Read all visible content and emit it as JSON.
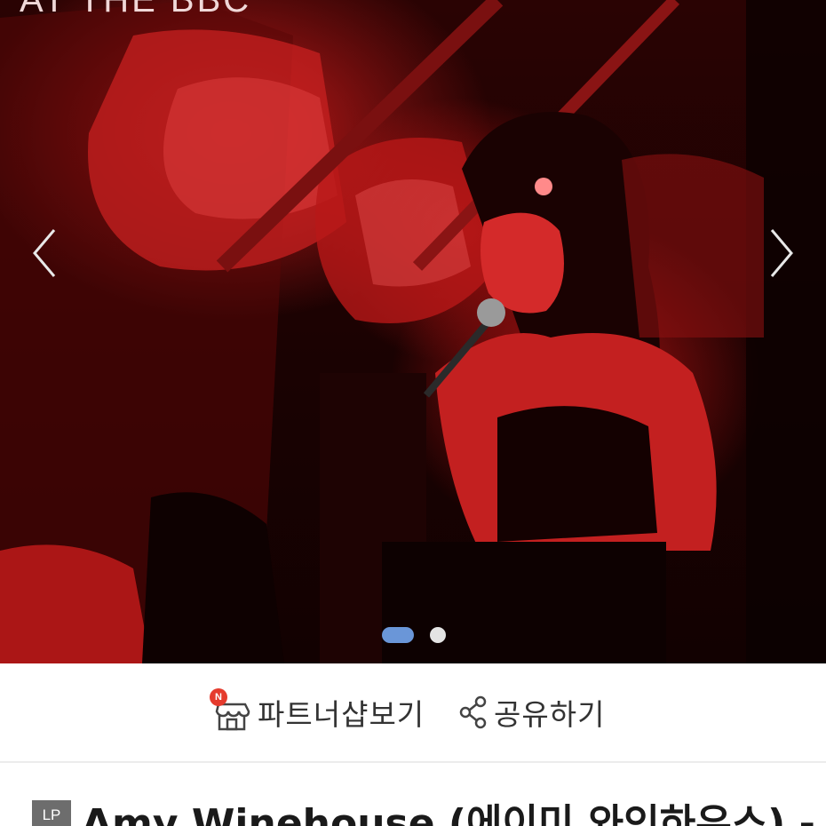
{
  "carousel": {
    "image_text": "AT THE BBC",
    "prev_icon": "chevron-left-icon",
    "next_icon": "chevron-right-icon",
    "slide_count": 2,
    "active_slide": 1,
    "colors": {
      "active_dot": "#6a96d8",
      "inactive_dot": "#e4e4e4",
      "tint": "#c81a1a"
    }
  },
  "actions": {
    "partner_shop": {
      "label": "파트너샵보기",
      "icon": "store-icon",
      "badge": "N",
      "badge_color": "#e53b2d"
    },
    "share": {
      "label": "공유하기",
      "icon": "share-icon"
    }
  },
  "product": {
    "badge": "LP",
    "title": "Amy Winehouse (에이미 와인하우스) -"
  }
}
